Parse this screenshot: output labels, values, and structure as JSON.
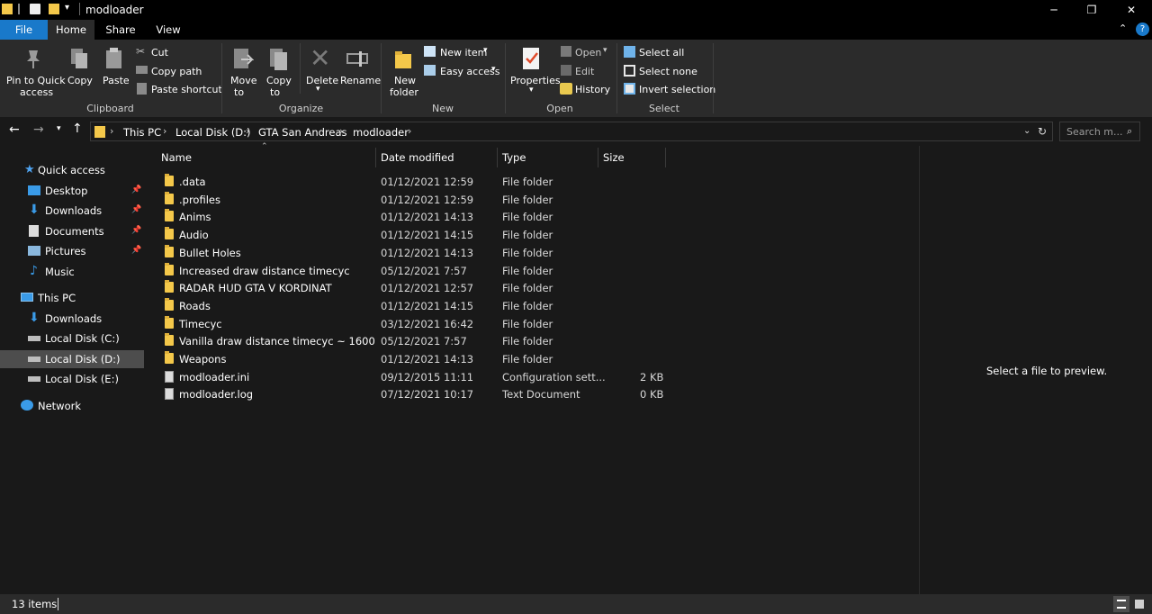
{
  "window": {
    "title": "modloader",
    "minimize": "─",
    "maximize": "❐",
    "close": "✕"
  },
  "tabs": {
    "file": "File",
    "home": "Home",
    "share": "Share",
    "view": "View"
  },
  "ribbon": {
    "clipboard": {
      "pin": "Pin to Quick",
      "pin2": "access",
      "copy": "Copy",
      "paste": "Paste",
      "cut": "Cut",
      "copy_path": "Copy path",
      "paste_shortcut": "Paste shortcut",
      "group": "Clipboard"
    },
    "organize": {
      "move": "Move",
      "move2": "to",
      "copyto": "Copy",
      "copyto2": "to",
      "delete": "Delete",
      "rename": "Rename",
      "group": "Organize"
    },
    "new": {
      "new_folder": "New",
      "new_folder2": "folder",
      "new_item": "New item",
      "easy_access": "Easy access",
      "group": "New"
    },
    "open": {
      "properties": "Properties",
      "open": "Open",
      "edit": "Edit",
      "history": "History",
      "group": "Open"
    },
    "select": {
      "select_all": "Select all",
      "select_none": "Select none",
      "invert": "Invert selection",
      "group": "Select"
    }
  },
  "address": {
    "crumbs": [
      "This PC",
      "Local Disk (D:)",
      "GTA San Andreas",
      "modloader"
    ],
    "search_placeholder": "Search m..."
  },
  "nav": {
    "quick_access": "Quick access",
    "desktop": "Desktop",
    "downloads": "Downloads",
    "documents": "Documents",
    "pictures": "Pictures",
    "music": "Music",
    "this_pc": "This PC",
    "pc_downloads": "Downloads",
    "disk_c": "Local Disk (C:)",
    "disk_d": "Local Disk (D:)",
    "disk_e": "Local Disk (E:)",
    "network": "Network"
  },
  "columns": {
    "name": "Name",
    "date": "Date modified",
    "type": "Type",
    "size": "Size"
  },
  "files": [
    {
      "name": ".data",
      "date": "01/12/2021 12:59",
      "type": "File folder",
      "size": "",
      "kind": "folder"
    },
    {
      "name": ".profiles",
      "date": "01/12/2021 12:59",
      "type": "File folder",
      "size": "",
      "kind": "folder"
    },
    {
      "name": "Anims",
      "date": "01/12/2021 14:13",
      "type": "File folder",
      "size": "",
      "kind": "folder"
    },
    {
      "name": "Audio",
      "date": "01/12/2021 14:15",
      "type": "File folder",
      "size": "",
      "kind": "folder"
    },
    {
      "name": "Bullet Holes",
      "date": "01/12/2021 14:13",
      "type": "File folder",
      "size": "",
      "kind": "folder"
    },
    {
      "name": "Increased draw distance timecyc",
      "date": "05/12/2021 7:57",
      "type": "File folder",
      "size": "",
      "kind": "folder"
    },
    {
      "name": "RADAR HUD GTA V KORDINAT",
      "date": "01/12/2021 12:57",
      "type": "File folder",
      "size": "",
      "kind": "folder"
    },
    {
      "name": "Roads",
      "date": "01/12/2021 14:15",
      "type": "File folder",
      "size": "",
      "kind": "folder"
    },
    {
      "name": "Timecyc",
      "date": "03/12/2021 16:42",
      "type": "File folder",
      "size": "",
      "kind": "folder"
    },
    {
      "name": "Vanilla draw distance timecyc ~ 1600",
      "date": "05/12/2021 7:57",
      "type": "File folder",
      "size": "",
      "kind": "folder"
    },
    {
      "name": "Weapons",
      "date": "01/12/2021 14:13",
      "type": "File folder",
      "size": "",
      "kind": "folder"
    },
    {
      "name": "modloader.ini",
      "date": "09/12/2015 11:11",
      "type": "Configuration sett...",
      "size": "2 KB",
      "kind": "file"
    },
    {
      "name": "modloader.log",
      "date": "07/12/2021 10:17",
      "type": "Text Document",
      "size": "0 KB",
      "kind": "file"
    }
  ],
  "preview": {
    "message": "Select a file to preview."
  },
  "status": {
    "items": "13 items"
  }
}
